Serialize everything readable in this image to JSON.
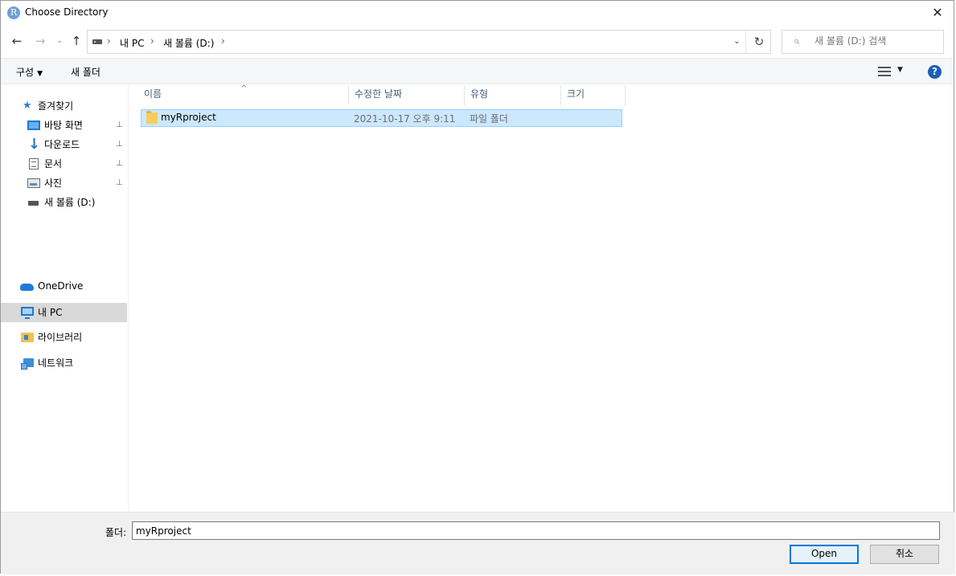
{
  "window": {
    "title": "Choose Directory",
    "app_icon": "R",
    "close_glyph": "✕"
  },
  "nav": {
    "back": "←",
    "forward": "→",
    "recent": "⌄",
    "up": "↑",
    "breadcrumb": [
      "내 PC",
      "새 볼륨 (D:)"
    ],
    "separator": "›",
    "dropdown": "⌄",
    "refresh": "↻",
    "search_placeholder": "새 볼륨 (D:) 검색"
  },
  "toolbar": {
    "organize": "구성",
    "organize_caret": "▼",
    "new_folder": "새 폴더",
    "view_caret": "▼",
    "help": "?"
  },
  "sidebar": {
    "quick_access": "즐겨찾기",
    "pinned": [
      {
        "label": "바탕 화면",
        "icon": "desktop-icon"
      },
      {
        "label": "다운로드",
        "icon": "download-icon"
      },
      {
        "label": "문서",
        "icon": "document-icon"
      },
      {
        "label": "사진",
        "icon": "pictures-icon"
      }
    ],
    "drive_d": "새 볼륨 (D:)",
    "onedrive": "OneDrive",
    "this_pc": "내 PC",
    "libraries": "라이브러리",
    "network": "네트워크",
    "pin_glyph": "📌"
  },
  "columns": {
    "name": "이름",
    "date": "수정한 날짜",
    "type": "유형",
    "size": "크기",
    "sort_indicator": "^"
  },
  "files": [
    {
      "name": "myRproject",
      "date": "2021-10-17 오후 9:11",
      "type": "파일 폴더",
      "size": ""
    }
  ],
  "bottom": {
    "folder_label": "폴더:",
    "folder_value": "myRproject",
    "open_label": "Open",
    "cancel_label": "취소"
  },
  "colors": {
    "accent": "#0078d7",
    "selection": "#cce8ff",
    "sidebar_selected": "#d9d9d9"
  }
}
